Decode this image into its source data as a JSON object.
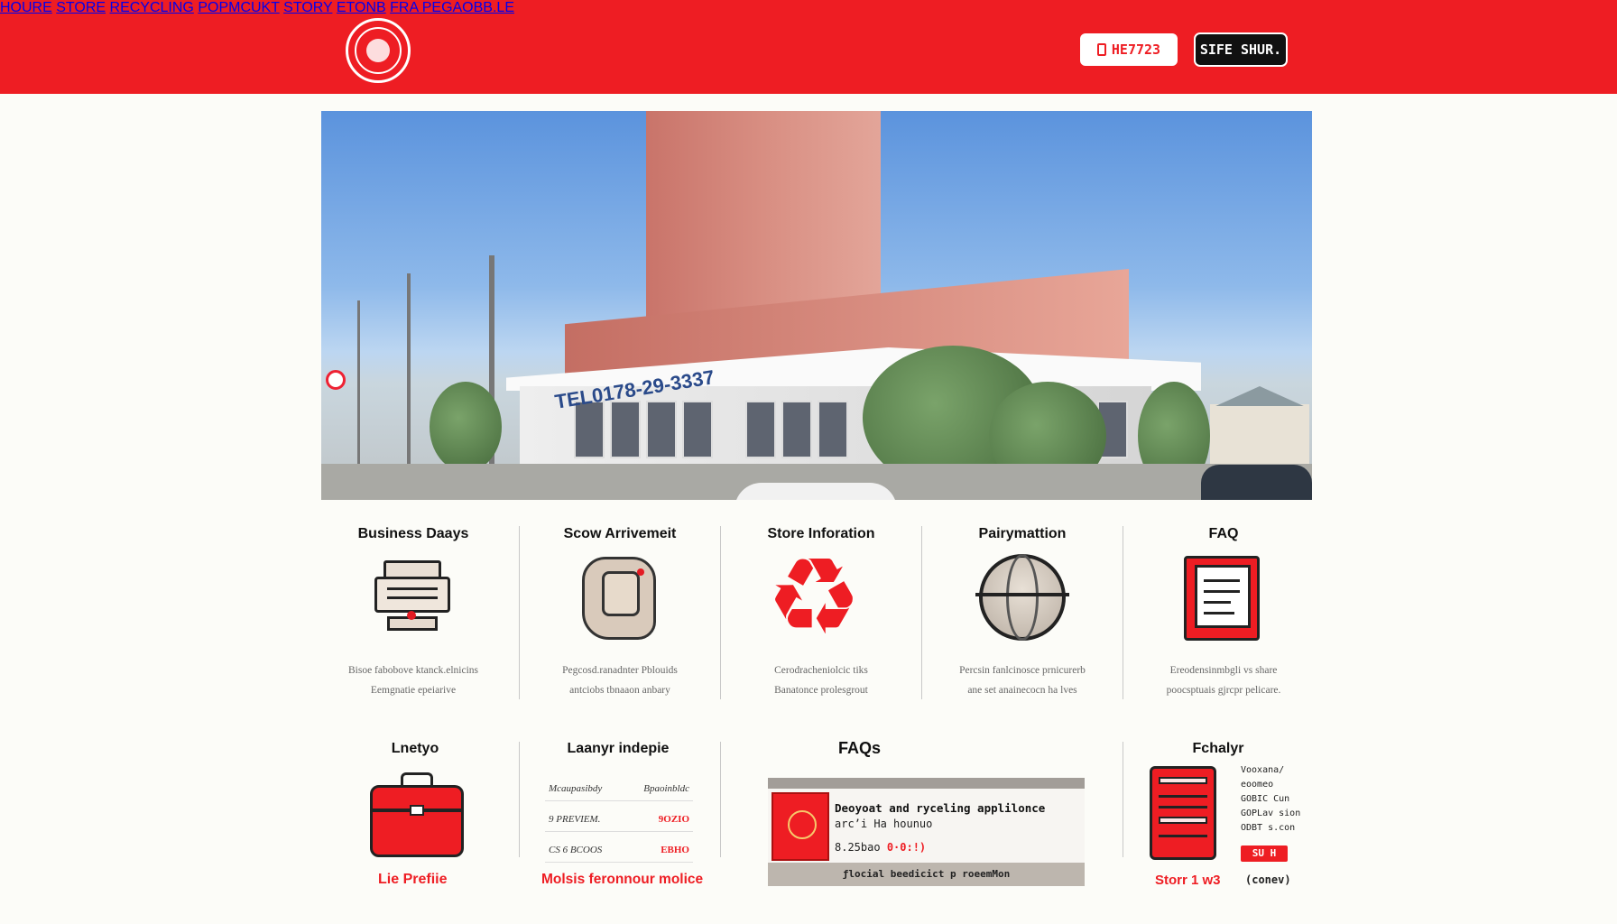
{
  "brand": {
    "color": "#ee1d23",
    "logo": "circular-seal-logo"
  },
  "nav": {
    "items": [
      "HOURE",
      "STORE",
      "RECYCLING",
      "POPMCUKT",
      "STORY",
      "ETONB",
      "FRA PEGAOBB.LE"
    ]
  },
  "header": {
    "phone_label": "HE7723",
    "shop_label": "SIFE SHUR."
  },
  "hero": {
    "image": "storefront-photo",
    "phone_sign": "TEL0178-29-3337"
  },
  "features": [
    {
      "title": "Business Daays",
      "icon": "printer-icon",
      "desc1": "Bisoe fabobove ktanck.elnicins",
      "desc2": "Eemgnatie epeiarive"
    },
    {
      "title": "Scow Arrivemeit",
      "icon": "bag-icon",
      "desc1": "Pegcosd.ranadnter Pblouids",
      "desc2": "antciobs tbnaaon anbary"
    },
    {
      "title": "Store Inforation",
      "icon": "recycle-icon",
      "desc1": "Cerodracheniolcic tiks",
      "desc2": "Banatonce prolesgrout"
    },
    {
      "title": "Pairymattion",
      "icon": "globe-icon",
      "desc1": "Percsin fanlcinosce prnicurerb",
      "desc2": "ane set anainecocn ha lves"
    },
    {
      "title": "FAQ",
      "icon": "document-icon",
      "desc1": "Ereodensinmbgli vs share",
      "desc2": "poocsptuais gjrcpr pelicare."
    }
  ],
  "row2": {
    "lineup": {
      "title": "Lnetyo",
      "icon": "briefcase-icon",
      "link": "Lie Prefiie"
    },
    "table": {
      "title": "Laanyr indepie",
      "rows": [
        {
          "left": "Mcaupasibdy",
          "right": "Bpaoinbldc",
          "right_red": false
        },
        {
          "left": "9 PREVIEM.",
          "right": "9OZIO",
          "right_red": true
        },
        {
          "left": "CS 6 BCOOS",
          "right": "EBHO",
          "right_red": true
        }
      ],
      "link": "Molsis feronnour molice"
    },
    "faqs": {
      "title": "FAQs",
      "line1": "Deoyoat and ryceling applilonce",
      "line2": "arc’i Ha hounuo",
      "line3_prefix": "8.25bao",
      "line3_red": "0·0:!)",
      "footer": "ƒlocial beedicict p roeemMon"
    },
    "fechyr": {
      "title": "Fchalyr",
      "icon": "cabinet-icon",
      "list": [
        "Vooxana/",
        "eoomeo",
        "GOBIC Cun",
        "GOPLav sion",
        "ODBT s.con"
      ],
      "btn": "SU H",
      "link_red": "Storr 1 w3",
      "link_dark": "(conev)"
    }
  }
}
